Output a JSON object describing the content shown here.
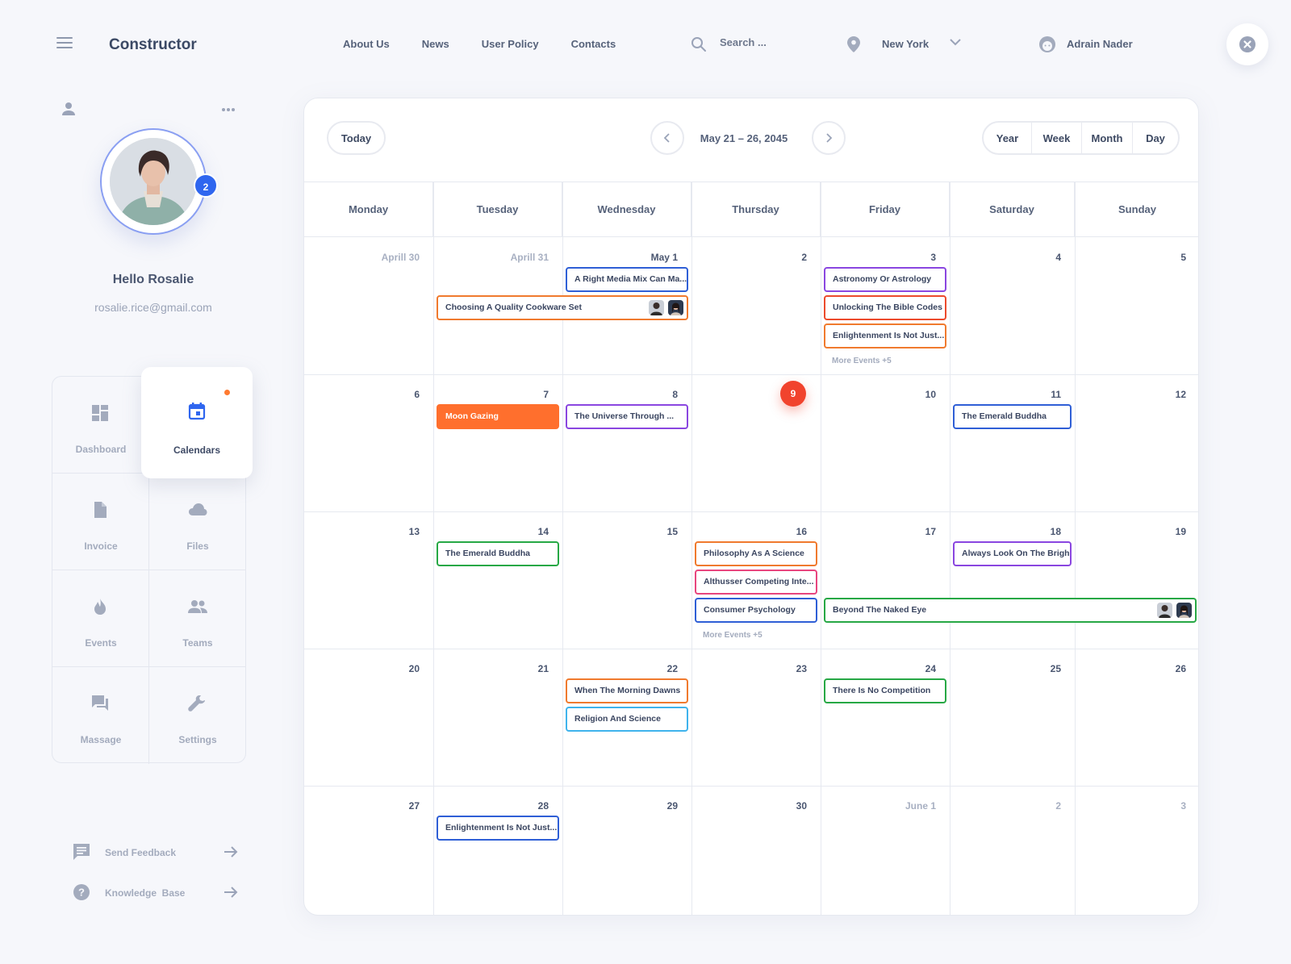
{
  "header": {
    "brand": "Constructor",
    "nav": [
      "About Us",
      "News",
      "User Policy",
      "Contacts"
    ],
    "search_placeholder": "Search ...",
    "location": "New York",
    "user_name": "Adrain Nader"
  },
  "profile": {
    "notification_count": "2",
    "greeting": "Hello Rosalie",
    "email": "rosalie.rice@gmail.com"
  },
  "sidebar_menu": [
    {
      "label": "Dashboard",
      "icon": "dashboard-icon"
    },
    {
      "label": "Calendars",
      "icon": "calendar-icon",
      "active": true
    },
    {
      "label": "Invoice",
      "icon": "invoice-icon"
    },
    {
      "label": "Files",
      "icon": "cloud-icon"
    },
    {
      "label": "Events",
      "icon": "flame-icon"
    },
    {
      "label": "Teams",
      "icon": "teams-icon"
    },
    {
      "label": "Massage",
      "icon": "chat-icon"
    },
    {
      "label": "Settings",
      "icon": "wrench-icon"
    }
  ],
  "footer_links": [
    {
      "label": "Send Feedback",
      "icon": "feedback-icon"
    },
    {
      "label": "Knowledge  Base",
      "icon": "help-icon"
    }
  ],
  "calendar": {
    "today_label": "Today",
    "range": "May 21 – 26, 2045",
    "views": [
      "Year",
      "Week",
      "Month",
      "Day"
    ],
    "weekdays": [
      "Monday",
      "Tuesday",
      "Wednesday",
      "Thursday",
      "Friday",
      "Saturday",
      "Sunday"
    ],
    "weeks": [
      [
        "Aprill 30",
        "Aprill 31",
        "May 1",
        "2",
        "3",
        "4",
        "5"
      ],
      [
        "6",
        "7",
        "8",
        "9",
        "10",
        "11",
        "12"
      ],
      [
        "13",
        "14",
        "15",
        "16",
        "17",
        "18",
        "19"
      ],
      [
        "20",
        "21",
        "22",
        "23",
        "24",
        "25",
        "26"
      ],
      [
        "27",
        "28",
        "29",
        "30",
        "June 1",
        "2",
        "3"
      ]
    ],
    "muted_days": [
      "0-0",
      "0-1",
      "4-4",
      "4-5",
      "4-6"
    ],
    "today_cell": "1-3",
    "colors": {
      "blue": "#2f5fd6",
      "orange": "#f07a2e",
      "purple": "#8a46e0",
      "red": "#ec4a2c",
      "green": "#27a845",
      "pink": "#e8457e",
      "cyan": "#3fb3ec",
      "orange_fill": "#ff6f2d"
    },
    "events": [
      {
        "title": "A Right Media Mix Can Ma...",
        "week": 0,
        "day": 2,
        "span": 1,
        "slot": 0,
        "color": "blue"
      },
      {
        "title": "Choosing A Quality Cookware Set",
        "week": 0,
        "day": 1,
        "span": 2,
        "slot": 1,
        "color": "orange",
        "avatars": 2
      },
      {
        "title": "Astronomy Or Astrology",
        "week": 0,
        "day": 4,
        "span": 1,
        "slot": 0,
        "color": "purple"
      },
      {
        "title": "Unlocking The Bible Codes",
        "week": 0,
        "day": 4,
        "span": 1,
        "slot": 1,
        "color": "red"
      },
      {
        "title": "Enlightenment Is Not Just...",
        "week": 0,
        "day": 4,
        "span": 1,
        "slot": 2,
        "color": "orange"
      },
      {
        "title": "Moon Gazing",
        "week": 1,
        "day": 1,
        "span": 1,
        "slot": 0,
        "color": "orange_fill",
        "filled": true
      },
      {
        "title": "The Universe Through ...",
        "week": 1,
        "day": 2,
        "span": 1,
        "slot": 0,
        "color": "purple"
      },
      {
        "title": "The Emerald Buddha",
        "week": 1,
        "day": 5,
        "span": 1,
        "slot": 0,
        "color": "blue"
      },
      {
        "title": "The Emerald Buddha",
        "week": 2,
        "day": 1,
        "span": 1,
        "slot": 0,
        "color": "green"
      },
      {
        "title": "Philosophy As A Science",
        "week": 2,
        "day": 3,
        "span": 1,
        "slot": 0,
        "color": "orange"
      },
      {
        "title": "Althusser Competing Inte...",
        "week": 2,
        "day": 3,
        "span": 1,
        "slot": 1,
        "color": "pink"
      },
      {
        "title": "Consumer Psychology",
        "week": 2,
        "day": 3,
        "span": 1,
        "slot": 2,
        "color": "blue"
      },
      {
        "title": "Always Look On The Brigh...",
        "week": 2,
        "day": 5,
        "span": 1,
        "slot": 0,
        "color": "purple"
      },
      {
        "title": "Beyond The Naked Eye",
        "week": 2,
        "day": 4,
        "span": 3,
        "slot": 2,
        "color": "green",
        "avatars": 2
      },
      {
        "title": "When The Morning Dawns",
        "week": 3,
        "day": 2,
        "span": 1,
        "slot": 0,
        "color": "orange"
      },
      {
        "title": "Religion And Science",
        "week": 3,
        "day": 2,
        "span": 1,
        "slot": 1,
        "color": "cyan"
      },
      {
        "title": "There Is No Competition",
        "week": 3,
        "day": 4,
        "span": 1,
        "slot": 0,
        "color": "green"
      },
      {
        "title": "Enlightenment Is Not Just...",
        "week": 4,
        "day": 1,
        "span": 1,
        "slot": 0,
        "color": "blue"
      }
    ],
    "more_events": [
      {
        "label": "More Events +5",
        "week": 0,
        "day": 4
      },
      {
        "label": "More Events +5",
        "week": 2,
        "day": 3
      }
    ]
  }
}
